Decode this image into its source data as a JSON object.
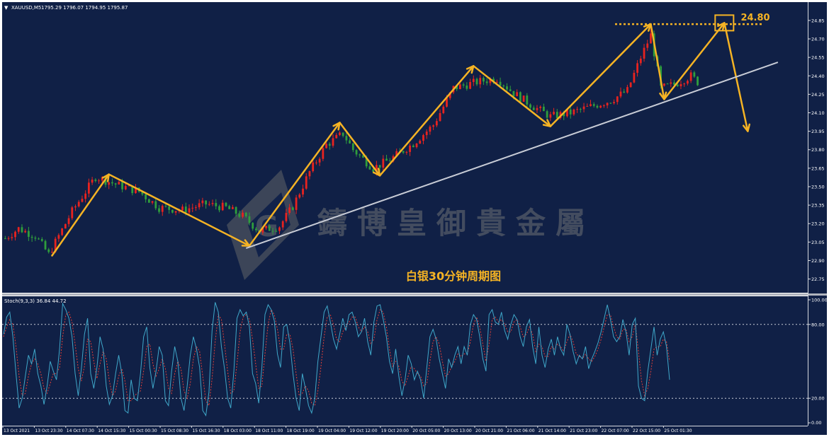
{
  "window": {
    "symbol_header": "XAUUSD,M5",
    "ohlc": "1795.29 1796.07 1794.95 1795.87"
  },
  "indicator": {
    "label": "Stoch(9,3,3) 36.84 44.72",
    "levels": [
      20,
      80
    ],
    "axis_labels": [
      "100.00",
      "80.00",
      "20.00",
      "0.00"
    ]
  },
  "annotations": {
    "caption": "白银30分钟周期图",
    "resistance_label": "24.80",
    "watermark": "鑄博皇御貴金屬"
  },
  "colors": {
    "background": "#102046",
    "bull": "#e8231f",
    "bear": "#2f9e3c",
    "arrow": "#f5b324",
    "trendline": "#c8ccd6",
    "stoch_main": "#3fa7c9",
    "stoch_signal": "#e0403a",
    "axis_text": "#ffffff"
  },
  "chart_data": [
    {
      "type": "candlestick",
      "title": "",
      "x_labels": [
        "13 Oct 2021",
        "13 Oct 23:30",
        "14 Oct 07:30",
        "14 Oct 15:30",
        "15 Oct 00:30",
        "15 Oct 08:30",
        "15 Oct 16:30",
        "18 Oct 03:00",
        "18 Oct 11:00",
        "18 Oct 19:00",
        "19 Oct 04:00",
        "19 Oct 12:00",
        "19 Oct 20:00",
        "20 Oct 05:00",
        "20 Oct 13:00",
        "20 Oct 21:00",
        "21 Oct 06:00",
        "21 Oct 14:00",
        "21 Oct 23:00",
        "22 Oct 07:00",
        "22 Oct 15:00",
        "25 Oct 01:30"
      ],
      "y_labels": [
        "24.85",
        "24.70",
        "24.55",
        "24.40",
        "24.25",
        "24.10",
        "23.95",
        "23.80",
        "23.65",
        "23.50",
        "23.35",
        "23.20",
        "23.05",
        "22.90",
        "22.75"
      ],
      "ylim": [
        22.65,
        24.97
      ],
      "price_path": [
        {
          "x": 0,
          "y": 23.08
        },
        {
          "x": 4,
          "y": 23.16
        },
        {
          "x": 9,
          "y": 23.1
        },
        {
          "x": 13,
          "y": 22.95
        },
        {
          "x": 20,
          "y": 23.3
        },
        {
          "x": 27,
          "y": 23.58
        },
        {
          "x": 33,
          "y": 23.52
        },
        {
          "x": 40,
          "y": 23.46
        },
        {
          "x": 46,
          "y": 23.33
        },
        {
          "x": 53,
          "y": 23.31
        },
        {
          "x": 60,
          "y": 23.36
        },
        {
          "x": 66,
          "y": 23.33
        },
        {
          "x": 71,
          "y": 23.26
        },
        {
          "x": 76,
          "y": 23.14
        },
        {
          "x": 82,
          "y": 23.18
        },
        {
          "x": 86,
          "y": 23.34
        },
        {
          "x": 91,
          "y": 23.62
        },
        {
          "x": 96,
          "y": 23.84
        },
        {
          "x": 101,
          "y": 23.93
        },
        {
          "x": 104,
          "y": 23.8
        },
        {
          "x": 110,
          "y": 23.65
        },
        {
          "x": 115,
          "y": 23.72
        },
        {
          "x": 122,
          "y": 23.85
        },
        {
          "x": 128,
          "y": 24.0
        },
        {
          "x": 134,
          "y": 24.3
        },
        {
          "x": 141,
          "y": 24.35
        },
        {
          "x": 147,
          "y": 24.38
        },
        {
          "x": 152,
          "y": 24.26
        },
        {
          "x": 158,
          "y": 24.15
        },
        {
          "x": 163,
          "y": 24.07
        },
        {
          "x": 169,
          "y": 24.1
        },
        {
          "x": 175,
          "y": 24.15
        },
        {
          "x": 181,
          "y": 24.2
        },
        {
          "x": 186,
          "y": 24.28
        },
        {
          "x": 190,
          "y": 24.55
        },
        {
          "x": 193,
          "y": 24.73
        },
        {
          "x": 196,
          "y": 24.3
        },
        {
          "x": 200,
          "y": 24.33
        },
        {
          "x": 205,
          "y": 24.4
        },
        {
          "x": 207,
          "y": 24.35
        }
      ],
      "zigzag": [
        {
          "x": 14,
          "y": 22.94
        },
        {
          "x": 31,
          "y": 23.6
        },
        {
          "x": 73,
          "y": 23.02
        },
        {
          "x": 100,
          "y": 24.02
        },
        {
          "x": 112,
          "y": 23.59
        },
        {
          "x": 140,
          "y": 24.48
        },
        {
          "x": 163,
          "y": 23.99
        },
        {
          "x": 193,
          "y": 24.82
        },
        {
          "x": 197,
          "y": 24.21
        },
        {
          "x": 215,
          "y": 24.83
        },
        {
          "x": 222,
          "y": 23.95
        }
      ],
      "trendline": [
        {
          "x": 72,
          "y": 23.0
        },
        {
          "x": 231,
          "y": 24.51
        }
      ],
      "resistance": 24.82,
      "stochastic": {
        "ylim": [
          0,
          100
        ],
        "k": [
          72,
          86,
          90,
          70,
          40,
          12,
          20,
          38,
          55,
          48,
          60,
          40,
          30,
          15,
          30,
          50,
          42,
          35,
          60,
          97,
          92,
          85,
          70,
          40,
          22,
          44,
          72,
          85,
          40,
          28,
          45,
          70,
          60,
          30,
          15,
          22,
          40,
          55,
          40,
          10,
          8,
          35,
          20,
          18,
          40,
          70,
          78,
          45,
          28,
          42,
          62,
          55,
          18,
          14,
          42,
          62,
          50,
          20,
          10,
          30,
          55,
          70,
          60,
          45,
          10,
          6,
          25,
          75,
          98,
          90,
          62,
          44,
          20,
          12,
          42,
          85,
          92,
          87,
          90,
          78,
          40,
          32,
          16,
          45,
          88,
          96,
          92,
          83,
          56,
          45,
          78,
          80,
          65,
          40,
          20,
          10,
          40,
          28,
          14,
          8,
          20,
          50,
          70,
          90,
          95,
          82,
          68,
          60,
          72,
          85,
          75,
          88,
          90,
          82,
          70,
          74,
          85,
          66,
          55,
          82,
          95,
          96,
          84,
          70,
          50,
          40,
          60,
          38,
          22,
          35,
          55,
          48,
          35,
          42,
          35,
          20,
          45,
          70,
          76,
          68,
          52,
          40,
          28,
          52,
          45,
          55,
          62,
          48,
          62,
          55,
          80,
          88,
          84,
          70,
          52,
          42,
          88,
          92,
          82,
          80,
          90,
          75,
          68,
          80,
          88,
          84,
          70,
          62,
          78,
          84,
          62,
          48,
          78,
          55,
          45,
          60,
          68,
          55,
          70,
          60,
          55,
          80,
          72,
          58,
          48,
          55,
          52,
          62,
          44,
          52,
          58,
          65,
          74,
          85,
          96,
          84,
          70,
          66,
          70,
          84,
          74,
          55,
          80,
          85,
          30,
          20,
          18,
          42,
          60,
          78,
          55,
          68,
          74,
          62,
          35
        ],
        "d": [
          70,
          78,
          84,
          80,
          62,
          38,
          22,
          24,
          38,
          48,
          52,
          48,
          40,
          28,
          24,
          32,
          40,
          40,
          45,
          70,
          88,
          90,
          82,
          64,
          44,
          34,
          46,
          68,
          66,
          50,
          36,
          48,
          58,
          52,
          34,
          22,
          26,
          38,
          44,
          34,
          18,
          18,
          22,
          24,
          26,
          42,
          62,
          64,
          48,
          38,
          44,
          52,
          44,
          28,
          24,
          40,
          50,
          44,
          26,
          20,
          32,
          52,
          62,
          58,
          38,
          18,
          14,
          36,
          66,
          88,
          84,
          64,
          42,
          24,
          26,
          48,
          74,
          86,
          88,
          84,
          68,
          48,
          28,
          30,
          56,
          80,
          92,
          88,
          76,
          60,
          60,
          72,
          72,
          60,
          40,
          22,
          24,
          30,
          26,
          16,
          14,
          26,
          46,
          70,
          86,
          88,
          80,
          68,
          66,
          74,
          78,
          82,
          86,
          86,
          78,
          74,
          78,
          74,
          64,
          68,
          84,
          92,
          90,
          78,
          60,
          46,
          50,
          46,
          34,
          30,
          38,
          46,
          44,
          40,
          38,
          30,
          32,
          50,
          66,
          70,
          64,
          50,
          38,
          40,
          46,
          50,
          56,
          54,
          56,
          56,
          66,
          80,
          86,
          78,
          64,
          50,
          64,
          84,
          86,
          82,
          84,
          80,
          74,
          74,
          82,
          84,
          78,
          70,
          72,
          78,
          72,
          58,
          64,
          62,
          54,
          54,
          62,
          60,
          64,
          62,
          58,
          66,
          72,
          66,
          56,
          54,
          52,
          56,
          52,
          50,
          54,
          60,
          68,
          78,
          88,
          88,
          78,
          70,
          68,
          76,
          76,
          66,
          70,
          80,
          58,
          34,
          22,
          28,
          42,
          60,
          62,
          62,
          68,
          66,
          50
        ]
      }
    }
  ]
}
